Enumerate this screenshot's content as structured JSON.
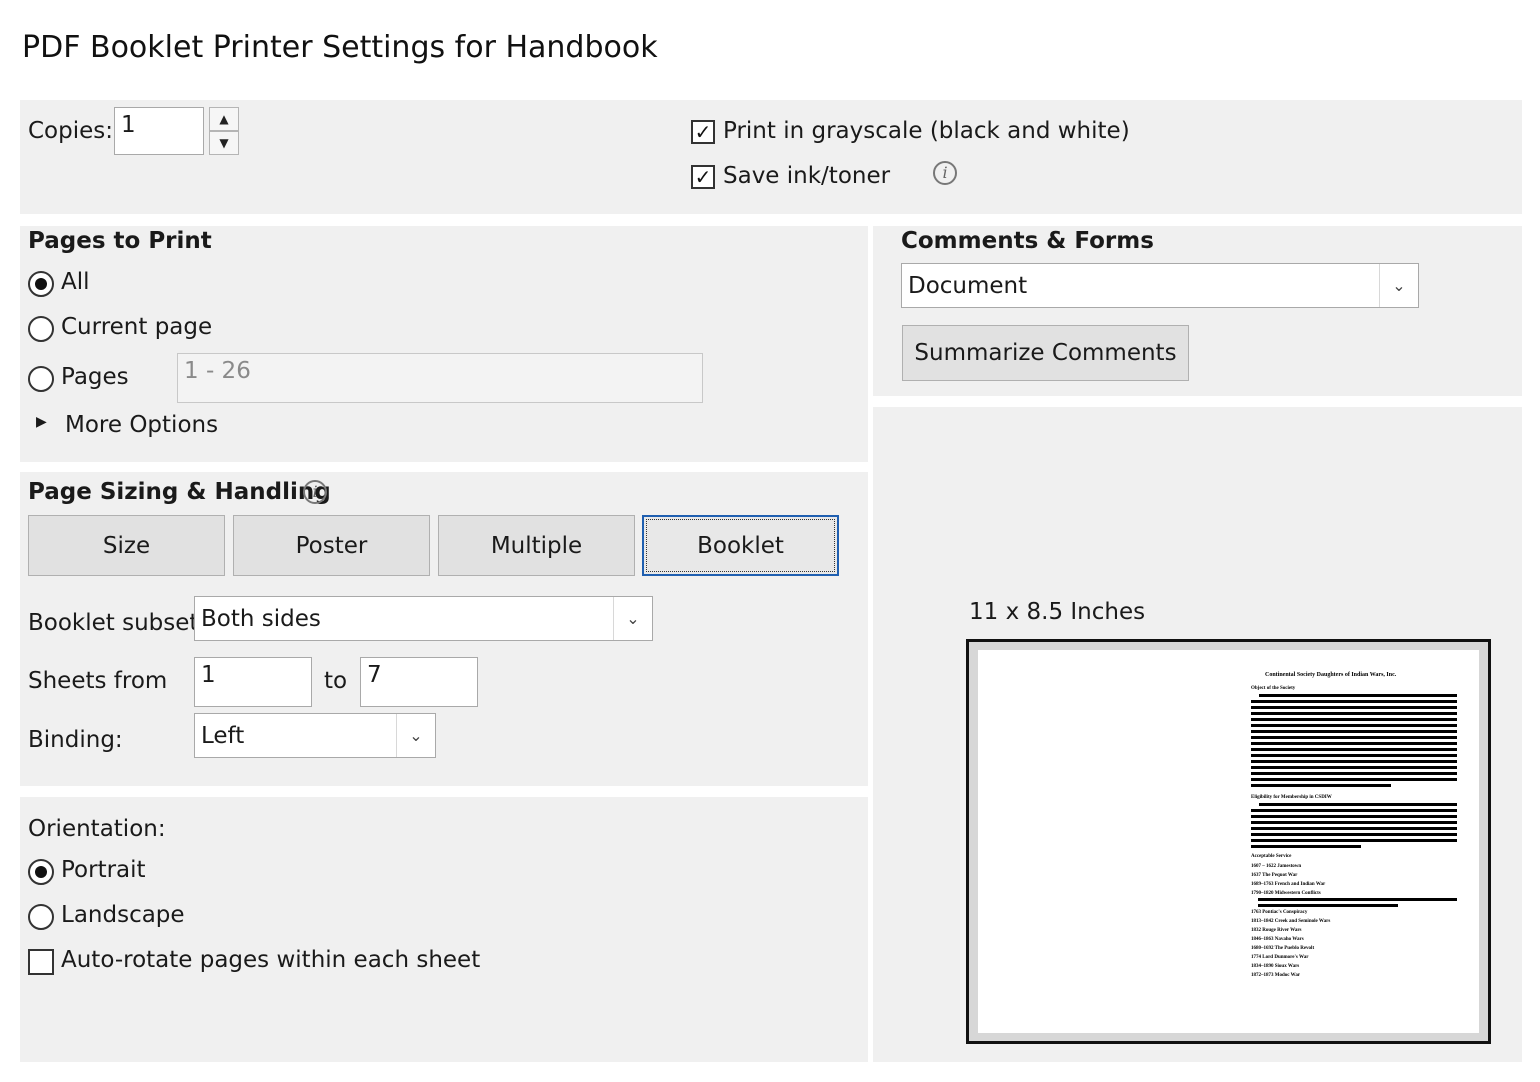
{
  "title": "PDF Booklet Printer Settings for Handbook",
  "copies": {
    "label": "Copies:",
    "value": "1"
  },
  "options": {
    "grayscale": {
      "label": "Print in grayscale (black and white)",
      "checked": true
    },
    "save_ink": {
      "label": "Save ink/toner",
      "checked": true
    }
  },
  "pages_to_print": {
    "heading": "Pages to Print",
    "all": "All",
    "current": "Current page",
    "pages": "Pages",
    "pages_value": "1 - 26",
    "more": "More Options",
    "selected": "All"
  },
  "comments_forms": {
    "heading": "Comments & Forms",
    "value": "Document",
    "summarize": "Summarize Comments"
  },
  "sizing": {
    "heading": "Page Sizing & Handling",
    "tabs": [
      "Size",
      "Poster",
      "Multiple",
      "Booklet"
    ],
    "selected_tab": "Booklet",
    "subset_label": "Booklet subset:",
    "subset_value": "Both sides",
    "sheets_label": "Sheets from",
    "sheets_from": "1",
    "sheets_to_label": "to",
    "sheets_to": "7",
    "binding_label": "Binding:",
    "binding_value": "Left"
  },
  "orientation": {
    "heading": "Orientation:",
    "portrait": "Portrait",
    "landscape": "Landscape",
    "selected": "Portrait",
    "autorotate": "Auto-rotate pages within each sheet",
    "autorotate_checked": false
  },
  "preview": {
    "size_label": "11 x 8.5 Inches",
    "doc_title": "Continental Society Daughters of Indian Wars, Inc.",
    "section1": "Object of the Society",
    "section2": "Eligibility for Membership in CSDIW",
    "section3": "Acceptable Service",
    "wars": [
      "1607 – 1622 Jamestown",
      "1637 The Pequot War",
      "1689–1763 French and Indian War",
      "1790–1820 Midwestern Conflicts",
      "1763 Pontiac's Conspiracy",
      "1813–1842 Creek and Seminole Wars",
      "1832 Rouge River Wars",
      "1846–1863 Navaho Wars",
      "1680–1692 The Pueblo Revolt",
      "1774 Lord Dunmore's War",
      "1834–1890 Sioux Wars",
      "1872–1873 Modoc War"
    ]
  }
}
